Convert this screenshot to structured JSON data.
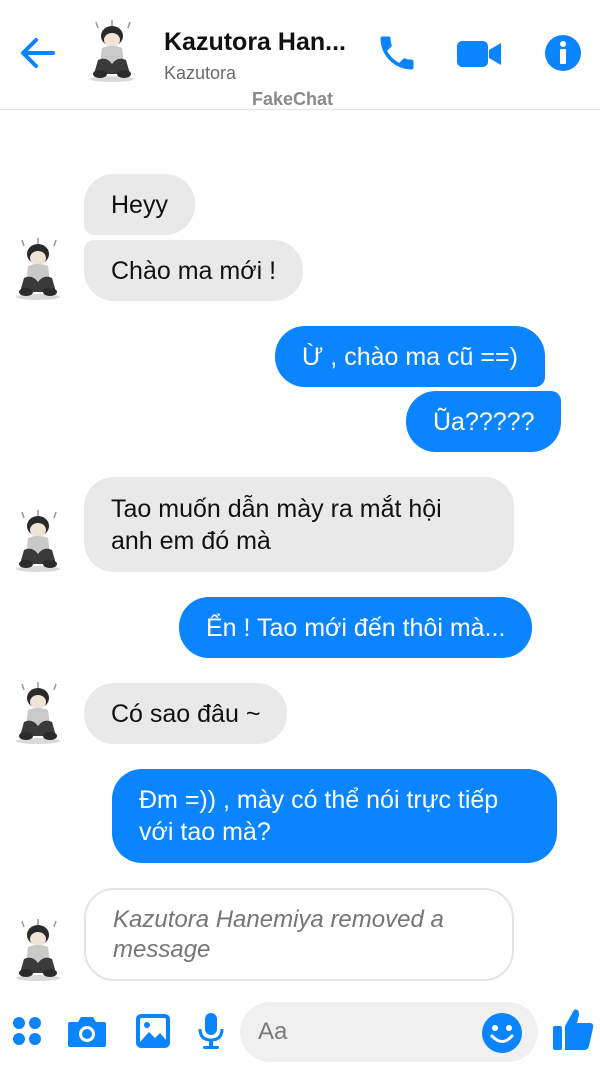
{
  "header": {
    "name": "Kazutora Han...",
    "subtitle": "Kazutora",
    "watermark": "FakeChat"
  },
  "messages": [
    {
      "from": "them",
      "text": "Heyy"
    },
    {
      "from": "them",
      "text": "Chào ma mới !"
    },
    {
      "from": "me",
      "text": "Ừ , chào ma cũ ==)"
    },
    {
      "from": "me",
      "text": "Ũa?????"
    },
    {
      "from": "them",
      "text": "Tao muốn dẫn mày ra mắt hội anh em đó mà"
    },
    {
      "from": "me",
      "text": "Ển ! Tao mới đến thôi mà..."
    },
    {
      "from": "them",
      "text": "Có sao đâu ~"
    },
    {
      "from": "me",
      "text": "Đm =)) , mày có thể nói trực tiếp với tao mà?"
    },
    {
      "from": "them",
      "text": "Kazutora Hanemiya  removed a message",
      "removed": true
    }
  ],
  "composer": {
    "placeholder": "Aa"
  },
  "colors": {
    "accent": "#0a84ff",
    "incoming_bubble": "#e9e9e9",
    "outgoing_bubble": "#0a84ff"
  },
  "icons": [
    "back-arrow-icon",
    "phone-icon",
    "video-camera-icon",
    "info-icon",
    "apps-grid-icon",
    "camera-icon",
    "gallery-icon",
    "microphone-icon",
    "emoji-icon",
    "thumbs-up-icon"
  ]
}
